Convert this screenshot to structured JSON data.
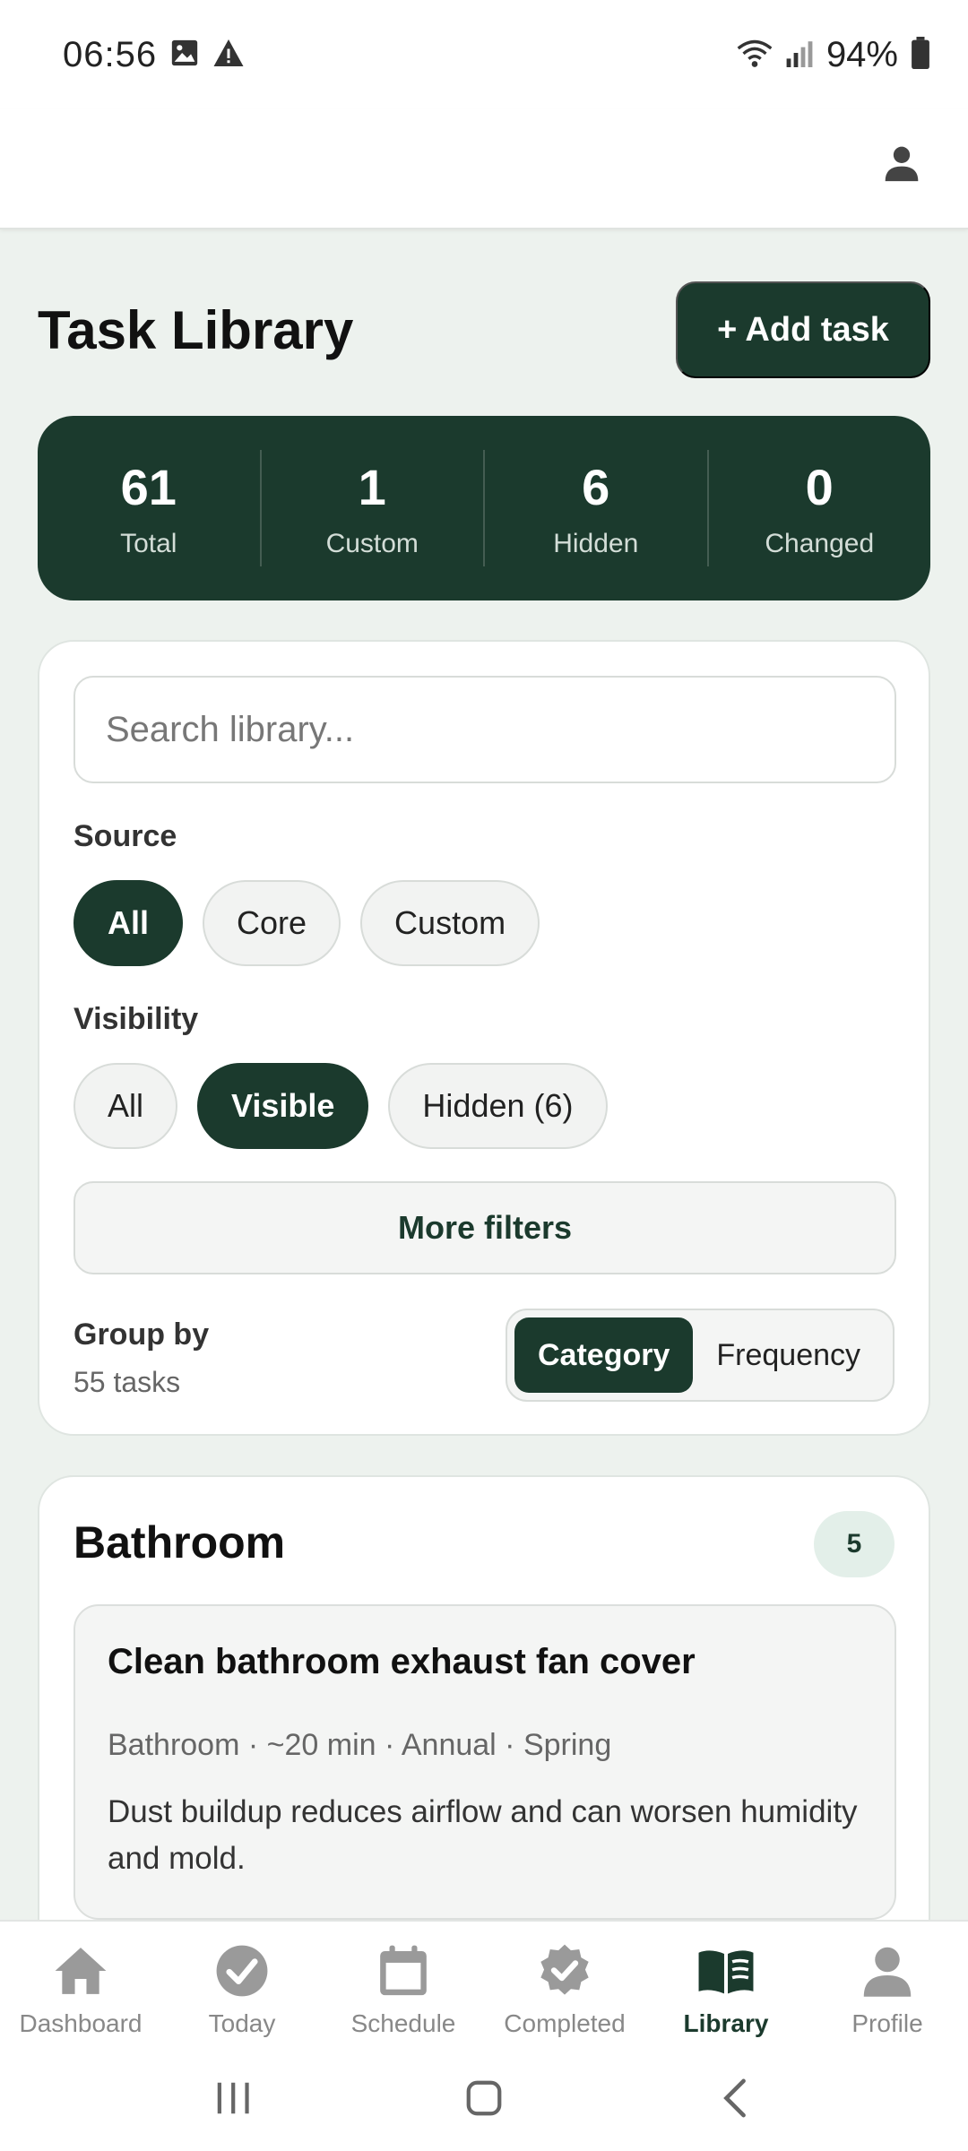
{
  "status_bar": {
    "time": "06:56",
    "battery": "94%"
  },
  "page": {
    "title": "Task Library",
    "add_button_label": "+ Add task"
  },
  "stats": [
    {
      "value": "61",
      "label": "Total"
    },
    {
      "value": "1",
      "label": "Custom"
    },
    {
      "value": "6",
      "label": "Hidden"
    },
    {
      "value": "0",
      "label": "Changed"
    }
  ],
  "filters": {
    "search_placeholder": "Search library...",
    "search_value": "",
    "source_label": "Source",
    "source_options": [
      "All",
      "Core",
      "Custom"
    ],
    "source_selected": "All",
    "visibility_label": "Visibility",
    "visibility_options": [
      "All",
      "Visible",
      "Hidden (6)"
    ],
    "visibility_selected": "Visible",
    "more_filters_label": "More filters",
    "group_by_label": "Group by",
    "task_count": "55 tasks",
    "group_options": [
      "Category",
      "Frequency"
    ],
    "group_selected": "Category"
  },
  "category": {
    "title": "Bathroom",
    "count": "5",
    "tasks": [
      {
        "title": "Clean bathroom exhaust fan cover",
        "meta": "Bathroom · ~20 min · Annual · Spring",
        "description": "Dust buildup reduces airflow and can worsen humidity and mold."
      }
    ]
  },
  "bottom_nav": [
    {
      "label": "Dashboard",
      "icon": "home-icon"
    },
    {
      "label": "Today",
      "icon": "check-circle-icon"
    },
    {
      "label": "Schedule",
      "icon": "calendar-icon"
    },
    {
      "label": "Completed",
      "icon": "badge-check-icon"
    },
    {
      "label": "Library",
      "icon": "book-icon"
    },
    {
      "label": "Profile",
      "icon": "person-icon"
    }
  ],
  "bottom_nav_active": "Library",
  "colors": {
    "primary": "#1b3a2d",
    "background": "#edf2ee",
    "badge_bg": "#e3efe9",
    "inactive": "#888888"
  }
}
